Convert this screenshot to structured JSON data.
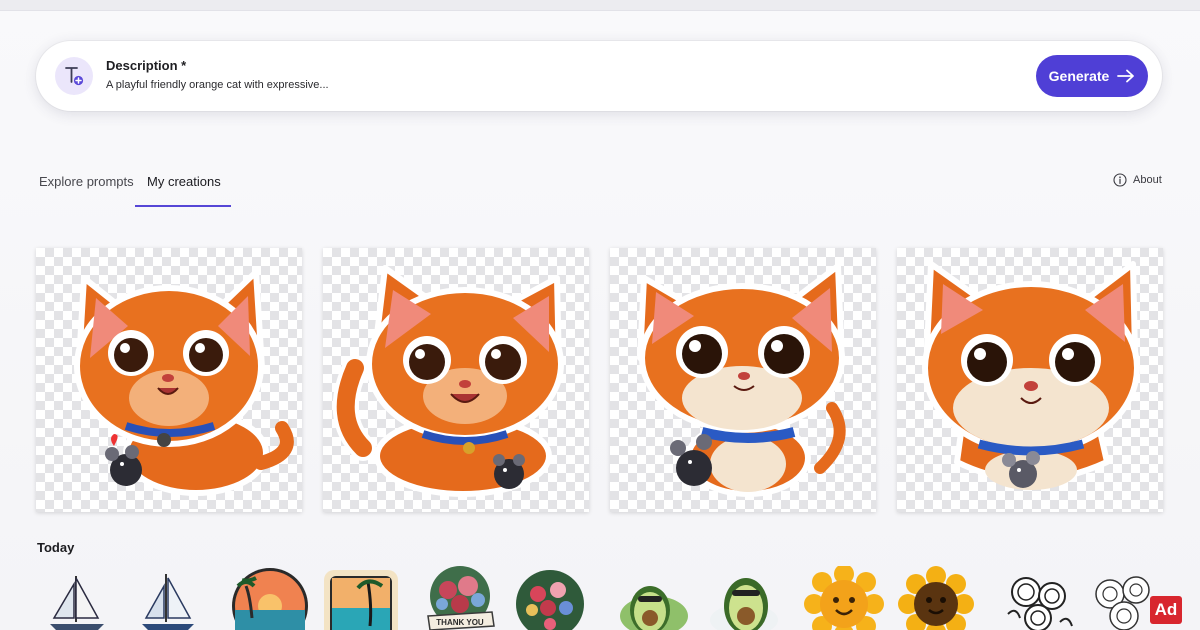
{
  "prompt": {
    "label": "Description *",
    "value": "A playful friendly orange cat with expressive...",
    "icon": "text-add-icon"
  },
  "generate": {
    "label": "Generate",
    "icon": "arrow-right-icon",
    "color": "#4f3fd6"
  },
  "tabs": [
    {
      "label": "Explore prompts",
      "active": false
    },
    {
      "label": "My creations",
      "active": true
    }
  ],
  "about": {
    "label": "About",
    "icon": "info-icon"
  },
  "creations": [
    {
      "subject": "orange-cat-sticker-with-mouse"
    },
    {
      "subject": "orange-cat-sticker-with-mouse"
    },
    {
      "subject": "orange-cat-sticker-with-mouse"
    },
    {
      "subject": "orange-cat-sticker-with-mouse"
    }
  ],
  "today": {
    "label": "Today",
    "items": [
      {
        "subject": "sailboat-sticker"
      },
      {
        "subject": "sailboat-sticker"
      },
      {
        "subject": "sunset-beach-sticker"
      },
      {
        "subject": "palm-beach-sticker"
      },
      {
        "subject": "thank-you-flowers-sticker",
        "text": "THANK YOU"
      },
      {
        "subject": "flower-bouquet-sticker"
      },
      {
        "subject": "avocado-sticker"
      },
      {
        "subject": "avocado-sticker"
      },
      {
        "subject": "sunflower-sticker"
      },
      {
        "subject": "sunflower-sticker"
      },
      {
        "subject": "roses-sticker"
      },
      {
        "subject": "roses-sticker"
      }
    ]
  },
  "watermark": "Ad",
  "colors": {
    "accent": "#4f3fd6",
    "tab_underline": "#5646d6",
    "cat_orange": "#e56a1c"
  }
}
